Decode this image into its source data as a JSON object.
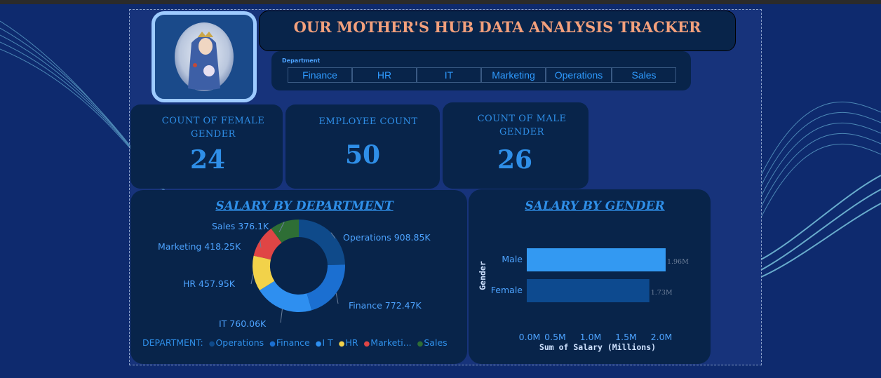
{
  "header": {
    "title": "OUR MOTHER'S HUB DATA ANALYSIS TRACKER",
    "photo_icon": "madonna-portrait"
  },
  "slicer": {
    "label": "Department",
    "options": [
      "Finance",
      "HR",
      "IT",
      "Marketing",
      "Operations",
      "Sales"
    ]
  },
  "kpis": {
    "female": {
      "title": "COUNT OF FEMALE GENDER",
      "value": "24"
    },
    "employees": {
      "title": "EMPLOYEE COUNT",
      "value": "50"
    },
    "male": {
      "title": "COUNT OF MALE GENDER",
      "value": "26"
    }
  },
  "legend": {
    "label": "DEPARTMENT:",
    "items": [
      "Operations",
      "Finance",
      "I T",
      "HR",
      "Marketi...",
      "Sales"
    ]
  },
  "colors": {
    "operations": "#0f4a8a",
    "finance": "#1b6fd1",
    "it": "#2e8ff0",
    "hr": "#f2d24a",
    "marketing": "#e04545",
    "sales": "#2e6e35",
    "male_bar": "#3399f2",
    "female_bar": "#0d4a8f"
  },
  "chart_data": [
    {
      "type": "pie",
      "title": "SALARY BY DEPARTMENT",
      "categories": [
        "Operations",
        "Finance",
        "IT",
        "HR",
        "Marketing",
        "Sales"
      ],
      "values": [
        908850,
        772470,
        760060,
        457950,
        418250,
        376100
      ],
      "labels": [
        "Operations 908.85K",
        "Finance 772.47K",
        "IT 760.06K",
        "HR 457.95K",
        "Marketing 418.25K",
        "Sales 376.1K"
      ]
    },
    {
      "type": "bar",
      "orientation": "horizontal",
      "title": "SALARY BY GENDER",
      "categories": [
        "Male",
        "Female"
      ],
      "values": [
        1.96,
        1.73
      ],
      "data_labels": [
        "1.96M",
        "1.73M"
      ],
      "xlabel": "Sum of Salary (Millions)",
      "ylabel": "Gender",
      "xticks": [
        "0.0M",
        "0.5M",
        "1.0M",
        "1.5M",
        "2.0M"
      ],
      "xlim": [
        0,
        2.0
      ]
    }
  ]
}
